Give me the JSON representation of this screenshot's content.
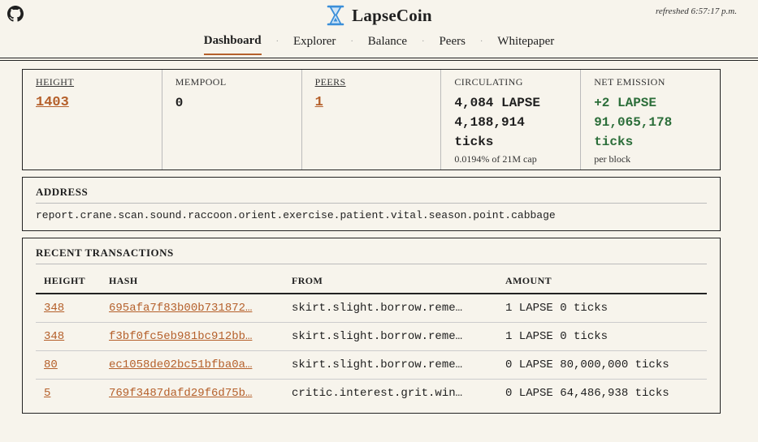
{
  "header": {
    "brand": "LapseCoin",
    "refreshed": "refreshed 6:57:17 p.m.",
    "nav": [
      "Dashboard",
      "Explorer",
      "Balance",
      "Peers",
      "Whitepaper"
    ],
    "active_nav": "Dashboard",
    "accent_color": "#b5602b"
  },
  "stats": {
    "height": {
      "label": "HEIGHT",
      "value": "1403"
    },
    "mempool": {
      "label": "MEMPOOL",
      "value": "0"
    },
    "peers": {
      "label": "PEERS",
      "value": "1"
    },
    "circulating": {
      "label": "CIRCULATING",
      "line1": "4,084 LAPSE",
      "line2": "4,188,914",
      "line3": "ticks",
      "note": "0.0194% of 21M cap"
    },
    "net_emission": {
      "label": "NET EMISSION",
      "line1": "+2 LAPSE",
      "line2": "91,065,178",
      "line3": "ticks",
      "note": "per block"
    }
  },
  "address": {
    "title": "ADDRESS",
    "value": "report.crane.scan.sound.raccoon.orient.exercise.patient.vital.season.point.cabbage"
  },
  "transactions": {
    "title": "RECENT TRANSACTIONS",
    "columns": [
      "HEIGHT",
      "HASH",
      "FROM",
      "AMOUNT"
    ],
    "rows": [
      {
        "height": "348",
        "hash": "695afa7f83b00b731872…",
        "from": "skirt.slight.borrow.reme…",
        "amount": "1 LAPSE 0 ticks"
      },
      {
        "height": "348",
        "hash": "f3bf0fc5eb981bc912bb…",
        "from": "skirt.slight.borrow.reme…",
        "amount": "1 LAPSE 0 ticks"
      },
      {
        "height": "80",
        "hash": "ec1058de02bc51bfba0a…",
        "from": "skirt.slight.borrow.reme…",
        "amount": "0 LAPSE 80,000,000 ticks"
      },
      {
        "height": "5",
        "hash": "769f3487dafd29f6d75b…",
        "from": "critic.interest.grit.win…",
        "amount": "0 LAPSE 64,486,938 ticks"
      }
    ]
  }
}
